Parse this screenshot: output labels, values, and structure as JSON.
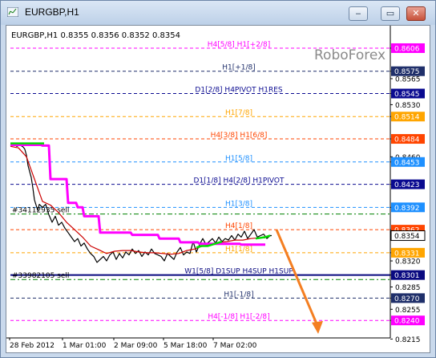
{
  "window": {
    "title": "EURGBP,H1",
    "buttons": {
      "minimize": "‒",
      "restore": "▭",
      "close": "✕"
    }
  },
  "chart_info": {
    "symbol_line": "EURGBP,H1  0.8355 0.8356 0.8352 0.8354",
    "watermark": "RoboForex"
  },
  "chart_data": {
    "type": "line",
    "symbol": "EURGBP",
    "timeframe": "H1",
    "ohlc_current": {
      "open": 0.8355,
      "high": 0.8356,
      "low": 0.8352,
      "close": 0.8354
    },
    "ylim": [
      0.821,
      0.862
    ],
    "price_ticks": [
      "0.8606",
      "0.8575",
      "0.8565",
      "0.8545",
      "0.8530",
      "0.8514",
      "0.8484",
      "0.8460",
      "0.8453",
      "0.8423",
      "0.8392",
      "0.8362",
      "0.8354",
      "0.8331",
      "0.8320",
      "0.8301",
      "0.8285",
      "0.8270",
      "0.8255",
      "0.8240",
      "0.8215"
    ],
    "time_labels": [
      "28 Feb 2012",
      "1 Mar 01:00",
      "2 Mar 09:00",
      "5 Mar 18:00",
      "7 Mar 02:00"
    ],
    "levels": [
      {
        "price": 0.8606,
        "label": "H4[5/8] H1[+2/8]",
        "color": "#ff00ff",
        "style": "dash",
        "badge": true
      },
      {
        "price": 0.8575,
        "label": "H1[+1/8]",
        "color": "#1f2f6a",
        "style": "dash",
        "badge": true
      },
      {
        "price": 0.8545,
        "label": "D1[2/8] H4PIVOT H1RES",
        "color": "#0a0a90",
        "style": "dash",
        "badge": true
      },
      {
        "price": 0.8514,
        "label": "H1[7/8]",
        "color": "#ffa500",
        "style": "dash",
        "badge": true
      },
      {
        "price": 0.8484,
        "label": "H4[3/8] H1[6/8]",
        "color": "#ff4500",
        "style": "dash",
        "badge": true
      },
      {
        "price": 0.8453,
        "label": "H1[5/8]",
        "color": "#1e90ff",
        "style": "dash",
        "badge": true
      },
      {
        "price": 0.8423,
        "label": "D1[1/8] H4[2/8] H1PIVOT",
        "color": "#0a0a90",
        "style": "dash",
        "badge": true
      },
      {
        "price": 0.8392,
        "label": "H1[3/8]",
        "color": "#1e90ff",
        "style": "dash",
        "badge": true
      },
      {
        "price": 0.8362,
        "label": "H4[1/8]",
        "color": "#ff4500",
        "style": "dash",
        "badge": true
      },
      {
        "price": 0.8331,
        "label": "H1[1/8]",
        "color": "#ffa500",
        "style": "dash",
        "badge": true
      },
      {
        "price": 0.8301,
        "label": "W1[5/8] D1SUP H4SUP H1SUP",
        "color": "#0a0a80",
        "style": "solid",
        "badge": true
      },
      {
        "price": 0.827,
        "label": "H1[-1/8]",
        "color": "#1f2f6a",
        "style": "dash",
        "badge": true
      },
      {
        "price": 0.824,
        "label": "H4[-1/8] H1[-2/8]",
        "color": "#ff00ff",
        "style": "dash",
        "badge": true
      }
    ],
    "order_lines": [
      {
        "price": 0.8383,
        "label": "#34112935 sell",
        "color": "#008000",
        "style": "dashdot"
      },
      {
        "price": 0.8295,
        "label": "#33982105 sell",
        "color": "#008000",
        "style": "dashdot"
      }
    ],
    "price_badge": {
      "price": 0.8354,
      "label": "0.8354"
    },
    "series": [
      {
        "color": "#000000",
        "x": [
          0,
          4,
          8,
          12,
          16,
          18,
          20,
          22,
          24,
          26,
          28,
          30,
          32,
          34,
          36,
          40,
          44,
          48,
          52,
          56,
          60,
          64,
          68,
          72,
          76,
          80,
          84,
          88,
          92,
          96,
          100,
          104,
          108,
          112,
          116,
          120,
          124,
          128,
          132,
          136,
          140,
          144,
          148,
          152,
          156,
          160,
          164,
          168,
          172,
          176,
          180,
          184,
          188,
          192,
          196,
          200,
          204,
          208,
          212,
          216,
          220,
          224,
          228,
          232,
          236,
          240,
          244,
          248,
          252,
          256,
          260,
          264,
          268,
          272,
          276,
          280,
          284,
          288,
          292,
          296,
          300,
          304,
          308,
          312,
          316,
          320,
          324,
          326
        ],
        "y": [
          0.8475,
          0.8478,
          0.8474,
          0.8476,
          0.8473,
          0.847,
          0.8462,
          0.8448,
          0.844,
          0.8432,
          0.8418,
          0.8402,
          0.8395,
          0.8388,
          0.8396,
          0.8392,
          0.8396,
          0.8382,
          0.8372,
          0.838,
          0.8368,
          0.8372,
          0.8364,
          0.8358,
          0.8352,
          0.8346,
          0.835,
          0.834,
          0.8344,
          0.8336,
          0.833,
          0.8326,
          0.8318,
          0.8322,
          0.8326,
          0.832,
          0.8328,
          0.8332,
          0.8322,
          0.833,
          0.8324,
          0.8332,
          0.8328,
          0.8336,
          0.833,
          0.8334,
          0.8326,
          0.8332,
          0.8328,
          0.8336,
          0.833,
          0.8328,
          0.8326,
          0.832,
          0.833,
          0.8326,
          0.8322,
          0.8332,
          0.8338,
          0.8328,
          0.8332,
          0.833,
          0.8346,
          0.8332,
          0.8342,
          0.835,
          0.8342,
          0.8346,
          0.835,
          0.8344,
          0.8352,
          0.8346,
          0.835,
          0.8348,
          0.8354,
          0.8348,
          0.8356,
          0.8352,
          0.836,
          0.835,
          0.8356,
          0.8362,
          0.8352,
          0.8354,
          0.8356,
          0.835,
          0.8354,
          0.8354
        ]
      },
      {
        "color": "#cc0000",
        "x": [
          0,
          10,
          20,
          30,
          40,
          50,
          60,
          70,
          80,
          90,
          100,
          110,
          120,
          130,
          140,
          150,
          160,
          170,
          180,
          190,
          200,
          210,
          220,
          230,
          240,
          250,
          260,
          270,
          280,
          290,
          300,
          310,
          318
        ],
        "y": [
          0.8474,
          0.8472,
          0.846,
          0.843,
          0.84,
          0.8395,
          0.8385,
          0.8372,
          0.8362,
          0.8352,
          0.834,
          0.8335,
          0.833,
          0.8333,
          0.8334,
          0.8334,
          0.8332,
          0.8331,
          0.8331,
          0.833,
          0.8329,
          0.833,
          0.8334,
          0.8336,
          0.834,
          0.8342,
          0.8345,
          0.8346,
          0.8348,
          0.8348,
          0.835,
          0.8351,
          0.8351
        ]
      },
      {
        "color": "#ff00ff",
        "x": [
          0,
          30,
          38,
          40,
          48,
          50,
          70,
          72,
          82,
          84,
          90,
          92,
          110,
          112,
          150,
          152,
          184,
          186,
          210,
          212,
          234,
          236,
          286,
          288,
          318
        ],
        "y": [
          0.8476,
          0.8476,
          0.8476,
          0.8475,
          0.8475,
          0.843,
          0.843,
          0.8398,
          0.8398,
          0.8392,
          0.8392,
          0.838,
          0.838,
          0.8358,
          0.8358,
          0.8355,
          0.8355,
          0.835,
          0.835,
          0.8345,
          0.8345,
          0.8343,
          0.8343,
          0.8342,
          0.8342
        ]
      },
      {
        "color": "#00dd00",
        "x": [
          0,
          8,
          18,
          26,
          34,
          42
        ],
        "y": [
          0.8478,
          0.8478,
          0.8478,
          0.8478,
          0.8478,
          0.8478
        ]
      },
      {
        "color": "#00dd00",
        "x": [
          232,
          238,
          246,
          252,
          258,
          264
        ],
        "y": [
          0.8338,
          0.834,
          0.834,
          0.8342,
          0.8344,
          0.8346
        ]
      },
      {
        "color": "#00dd00",
        "x": [
          306,
          312,
          318,
          324
        ],
        "y": [
          0.835,
          0.8351,
          0.8352,
          0.8354
        ]
      }
    ],
    "annotation_arrow": {
      "color": "#f47f22",
      "from": [
        332,
        0.8362
      ],
      "to": [
        384,
        0.8222
      ]
    }
  }
}
